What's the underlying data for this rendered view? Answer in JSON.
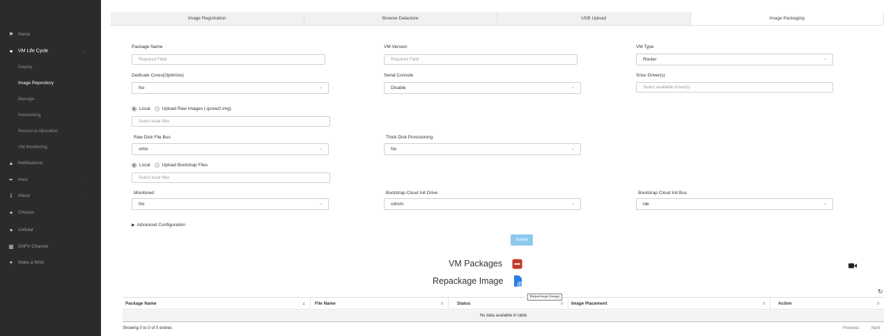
{
  "sidebar": {
    "items": [
      {
        "label": "Home",
        "icon": "home-icon"
      },
      {
        "label": "VM Life Cycle",
        "icon": "cloud-icon"
      },
      {
        "label": "Deploy"
      },
      {
        "label": "Image Repository"
      },
      {
        "label": "Manage"
      },
      {
        "label": "Networking"
      },
      {
        "label": "Resource Allocation"
      },
      {
        "label": "VM Monitoring"
      },
      {
        "label": "Notifications",
        "icon": "bell-icon"
      },
      {
        "label": "Host",
        "icon": "wrench-icon"
      },
      {
        "label": "About",
        "icon": "info-icon"
      },
      {
        "label": "Chassis",
        "icon": "cloud-icon"
      },
      {
        "label": "Cellular",
        "icon": "cloud-icon"
      },
      {
        "label": "ENFV Channel",
        "icon": "building-icon"
      },
      {
        "label": "Make a Wish",
        "icon": "wand-icon"
      }
    ]
  },
  "tabs": [
    "Image Registration",
    "Browse Datastore",
    "USB Upload",
    "Image Packaging"
  ],
  "form": {
    "package_name_label": "Package Name",
    "package_name_placeholder": "Required Field",
    "vm_version_label": "VM Version",
    "vm_version_placeholder": "Required Field",
    "vm_type_label": "VM Type",
    "vm_type_value": "Router",
    "dedicate_cores_label": "Dedicate Cores(Optimize)",
    "dedicate_cores_value": "No",
    "serial_console_label": "Serial Console",
    "serial_console_value": "Disable",
    "sriov_label": "Sriov Driver(s)",
    "sriov_placeholder": "Select available driver(s)",
    "local_label": "Local",
    "upload_raw_label": "Upload Raw Images (.qcow2/.img)",
    "select_local_files_1": "Select local files",
    "raw_disk_bus_label": "Raw Disk File Bus",
    "raw_disk_bus_value": "virtio",
    "thick_disk_label": "Thick Disk Provisioning",
    "thick_disk_value": "No",
    "local_label_2": "Local",
    "upload_bootstrap_label": "Upload Bootstrap Files",
    "select_local_files_2": "Select local files",
    "monitored_label": "Monitored",
    "monitored_value": "No",
    "bootstrap_drive_label": "Bootstrap Cloud Init Drive",
    "bootstrap_drive_value": "cdrom",
    "bootstrap_bus_label": "Bootstrap Cloud Init Bus",
    "bootstrap_bus_value": "ide",
    "advanced_label": "Advanced Configuration",
    "submit_label": "Submit"
  },
  "packages": {
    "title": "VM Packages",
    "repackage_title": "Repackage Image",
    "tooltip": "Repackage Image",
    "columns": [
      "Package Name",
      "File Name",
      "Status",
      "Image Placement",
      "Action"
    ],
    "empty_text": "No data available in table",
    "showing": "Showing 0 to 0 of 0 entries",
    "previous": "Previous",
    "next": "Next"
  },
  "colors": {
    "sidebar_bg": "#2b2b2b",
    "minus_button": "#c0392b",
    "repackage_icon": "#2a7de1",
    "submit_bg": "#8ec8ef"
  }
}
